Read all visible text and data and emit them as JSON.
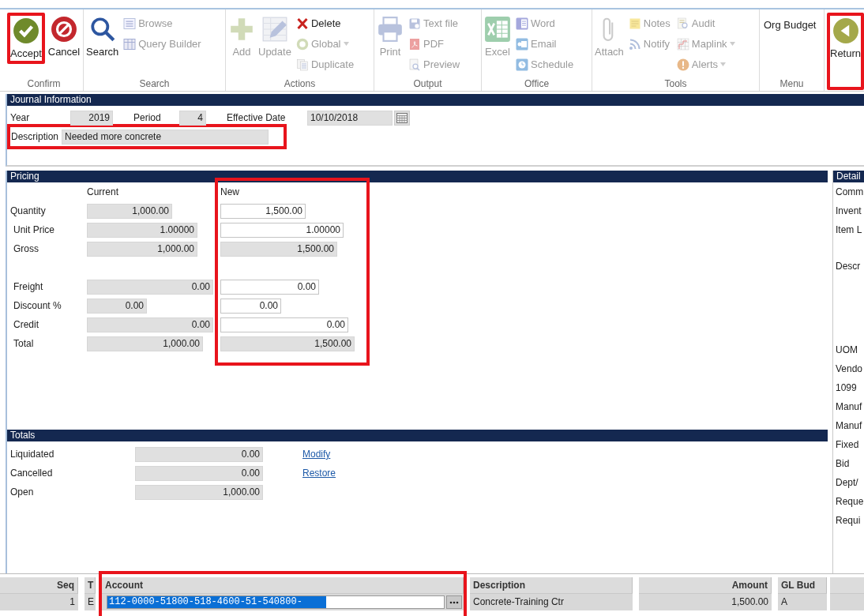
{
  "toolbar": {
    "groups": [
      {
        "label": "Confirm",
        "columns": [
          [
            {
              "label": "Accept",
              "kind": "large",
              "disabled": false,
              "highlighted": true
            }
          ],
          [
            {
              "label": "Cancel",
              "kind": "large",
              "disabled": false,
              "highlighted": false
            }
          ]
        ]
      },
      {
        "label": "Search",
        "columns": [
          [
            {
              "label": "Search",
              "kind": "large",
              "disabled": false,
              "highlighted": false
            }
          ],
          [
            {
              "label": "Browse",
              "kind": "small",
              "disabled": true
            },
            {
              "label": "Query Builder",
              "kind": "small",
              "disabled": true
            }
          ]
        ]
      },
      {
        "label": "Actions",
        "columns": [
          [
            {
              "label": "Add",
              "kind": "large",
              "disabled": true,
              "highlighted": false
            }
          ],
          [
            {
              "label": "Update",
              "kind": "large",
              "disabled": true,
              "highlighted": false
            }
          ],
          [
            {
              "label": "Delete",
              "kind": "small",
              "disabled": false
            },
            {
              "label": "Global",
              "kind": "small",
              "disabled": true,
              "dropdown": true
            },
            {
              "label": "Duplicate",
              "kind": "small",
              "disabled": true
            }
          ]
        ]
      },
      {
        "label": "Output",
        "columns": [
          [
            {
              "label": "Print",
              "kind": "large",
              "disabled": true,
              "highlighted": false
            }
          ],
          [
            {
              "label": "Text file",
              "kind": "small",
              "disabled": true
            },
            {
              "label": "PDF",
              "kind": "small",
              "disabled": true
            },
            {
              "label": "Preview",
              "kind": "small",
              "disabled": true
            }
          ]
        ]
      },
      {
        "label": "Office",
        "columns": [
          [
            {
              "label": "Excel",
              "kind": "large",
              "disabled": true,
              "highlighted": false
            }
          ],
          [
            {
              "label": "Word",
              "kind": "small",
              "disabled": true
            },
            {
              "label": "Email",
              "kind": "small",
              "disabled": true
            },
            {
              "label": "Schedule",
              "kind": "small",
              "disabled": true
            }
          ]
        ]
      },
      {
        "label": "Tools",
        "columns": [
          [
            {
              "label": "Attach",
              "kind": "large",
              "disabled": true,
              "highlighted": false
            }
          ],
          [
            {
              "label": "Notes",
              "kind": "small",
              "disabled": true
            },
            {
              "label": "Notify",
              "kind": "small",
              "disabled": true
            }
          ],
          [
            {
              "label": "Audit",
              "kind": "small",
              "disabled": true
            },
            {
              "label": "Maplink",
              "kind": "small",
              "disabled": true,
              "dropdown": true
            },
            {
              "label": "Alerts",
              "kind": "small",
              "disabled": true,
              "dropdown": true
            }
          ]
        ]
      },
      {
        "label": "Menu",
        "columns": [
          [
            {
              "label": "Org Budget",
              "kind": "text",
              "disabled": false
            }
          ]
        ]
      },
      {
        "columns": [
          [
            {
              "label": "Return",
              "kind": "large",
              "disabled": false,
              "highlighted": true
            }
          ]
        ]
      }
    ]
  },
  "journal": {
    "title": "Journal Information",
    "year": {
      "label": "Year",
      "value": "2019"
    },
    "period": {
      "label": "Period",
      "value": "4"
    },
    "effective_date": {
      "label": "Effective Date",
      "value": "10/10/2018"
    },
    "description": {
      "label": "Description",
      "value": "Needed more concrete",
      "highlighted": true
    }
  },
  "pricing": {
    "title": "Pricing",
    "current_heading": "Current",
    "new_heading": "New",
    "new_highlighted": true,
    "groups": [
      [
        {
          "label": "Quantity",
          "current": "1,000.00",
          "new": "1,500.00",
          "new_editable": true
        },
        {
          "label": "Unit Price",
          "current": "1.00000",
          "new": "1.00000",
          "new_editable": true
        },
        {
          "label": "Gross",
          "current": "1,000.00",
          "new": "1,500.00",
          "new_editable": false
        }
      ],
      [
        {
          "label": "Freight",
          "current": "0.00",
          "new": "0.00",
          "new_editable": true
        },
        {
          "label": "Discount %",
          "current": "0.00",
          "new": "0.00",
          "new_editable": true
        },
        {
          "label": "Credit",
          "current": "0.00",
          "new": "0.00",
          "new_editable": true
        },
        {
          "label": "Total",
          "current": "1,000.00",
          "new": "1,500.00",
          "new_editable": false
        }
      ]
    ]
  },
  "totals": {
    "title": "Totals",
    "rows": [
      {
        "label": "Liquidated",
        "value": "0.00",
        "link": "Modify"
      },
      {
        "label": "Cancelled",
        "value": "0.00",
        "link": "Restore"
      },
      {
        "label": "Open",
        "value": "1,000.00"
      }
    ]
  },
  "detail": {
    "title": "Detail",
    "groups": [
      [
        "Comm",
        "Invent",
        "Item L"
      ],
      [
        "Descr"
      ],
      [
        "UOM",
        "Vendo",
        "1099",
        "Manuf",
        "Manuf",
        "Fixed",
        "Bid",
        "Dept/",
        "Reque",
        "Requi"
      ]
    ]
  },
  "grid": {
    "columns": [
      {
        "label": "Seq",
        "highlighted": false
      },
      {
        "label": "T",
        "highlighted": false
      },
      {
        "label": "Account",
        "highlighted": true
      },
      {
        "label": "Description",
        "highlighted": false
      },
      {
        "label": "Amount",
        "highlighted": false
      },
      {
        "label": "GL Bud",
        "highlighted": false
      }
    ],
    "rows": [
      {
        "cells": [
          "1",
          "E",
          "112-0000-51800-518-4600-51-540800-",
          "Concrete-Training Ctr",
          "1,500.00",
          "A"
        ],
        "account_text_selected": true
      }
    ]
  }
}
